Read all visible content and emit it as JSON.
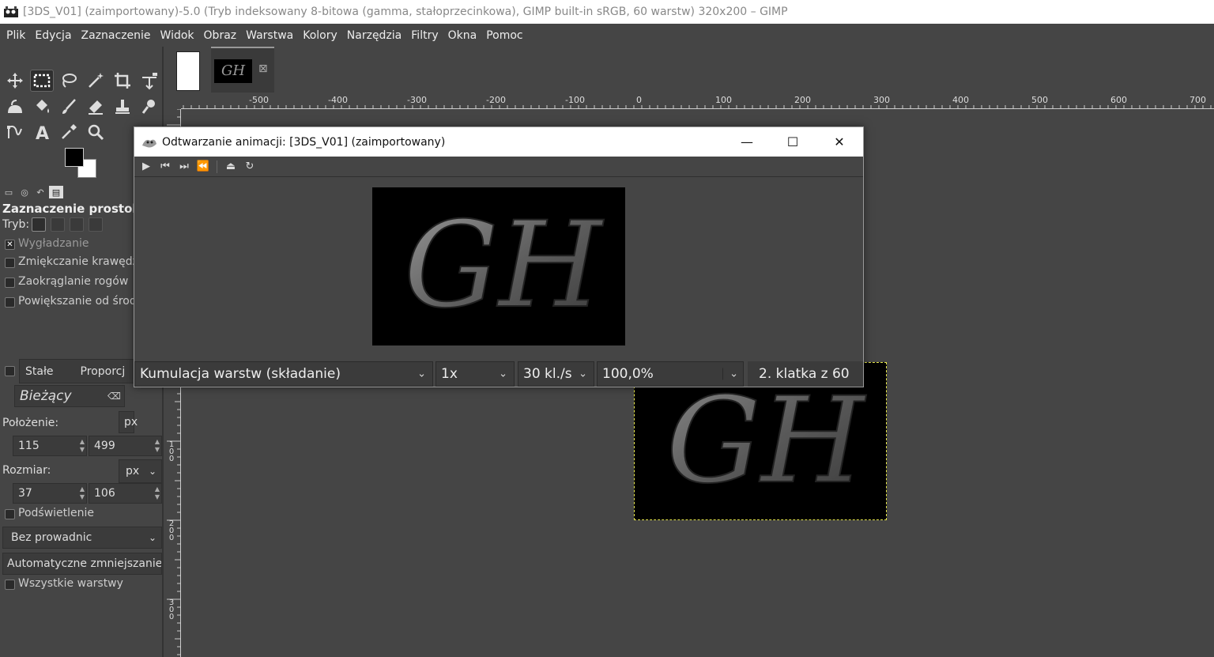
{
  "window": {
    "title": "[3DS_V01] (zaimportowany)-5.0 (Tryb indeksowany 8-bitowa (gamma, stałoprzecinkowa), GIMP built-in sRGB, 60 warstw) 320x200 – GIMP"
  },
  "menubar": {
    "items": [
      "Plik",
      "Edycja",
      "Zaznaczenie",
      "Widok",
      "Obraz",
      "Warstwa",
      "Kolory",
      "Narzędzia",
      "Filtry",
      "Okna",
      "Pomoc"
    ]
  },
  "tool_options": {
    "title": "Zaznaczenie prostok",
    "mode_label": "Tryb:",
    "antialias_label": "Wygładzanie",
    "feather_label": "Zmiękczanie krawędz",
    "rounded_label": "Zaokrąglanie rogów",
    "expand_label": "Powiększanie od środ",
    "fixed_label": "Stałe",
    "fixed_value": "Proporcj",
    "preset_value": "Bieżący",
    "position_label": "Położenie:",
    "position_unit": "px",
    "position_x": "115",
    "position_y": "499",
    "size_label": "Rozmiar:",
    "size_unit": "px",
    "size_w": "37",
    "size_h": "106",
    "highlight_label": "Podświetlenie",
    "guides_value": "Bez prowadnic",
    "autoshrink_label": "Automatyczne zmniejszanie",
    "all_layers_label": "Wszystkie warstwy"
  },
  "image_tabs": {
    "thumb_text": "GH"
  },
  "ruler": {
    "h_labels": [
      "-500",
      "-400",
      "-300",
      "-200",
      "-100",
      "0",
      "100",
      "200",
      "300",
      "400",
      "500",
      "600",
      "700"
    ],
    "v_labels": [
      "1\n0\n0",
      "2\n0\n0",
      "3\n0\n0"
    ]
  },
  "canvas": {
    "image_text": "GH"
  },
  "animation_dialog": {
    "title": "Odtwarzanie animacji: [3DS_V01] (zaimportowany)",
    "frame_text": "GH",
    "mode_value": "Kumulacja warstw (składanie)",
    "speed_value": "1x",
    "fps_value": "30 kl./s",
    "zoom_value": "100,0%",
    "frame_label": "2. klatka z 60"
  },
  "colors": {
    "accent_selection": "#e6e64c",
    "background": "#454545"
  }
}
